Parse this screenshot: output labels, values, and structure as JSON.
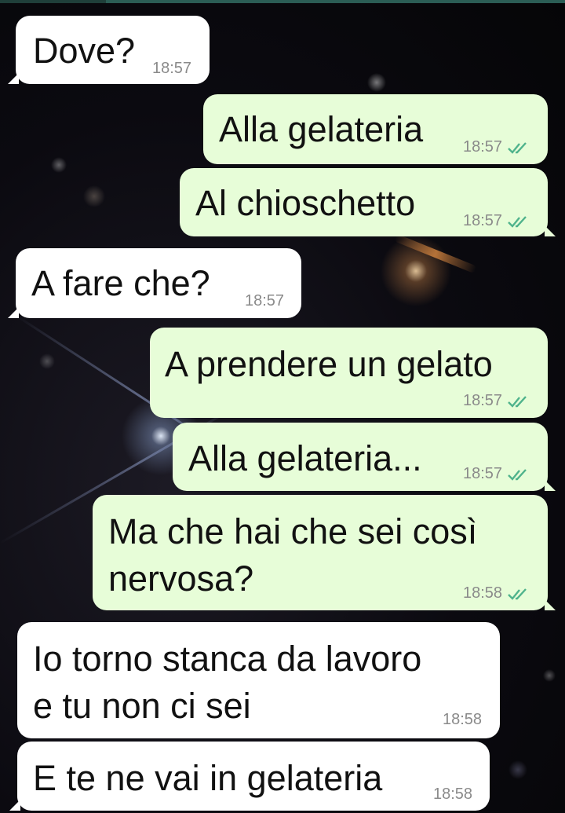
{
  "colors": {
    "incoming_bubble": "#ffffff",
    "outgoing_bubble": "#e7fdd8",
    "read_ticks": "#4fb38c",
    "timestamp": "#8a8a8a"
  },
  "messages": [
    {
      "direction": "in",
      "lines": [
        "Dove?"
      ],
      "time": "18:57"
    },
    {
      "direction": "out",
      "lines": [
        "Alla gelateria"
      ],
      "time": "18:57",
      "status_icon": "double-check-read"
    },
    {
      "direction": "out",
      "lines": [
        "Al chioschetto"
      ],
      "time": "18:57",
      "status_icon": "double-check-read"
    },
    {
      "direction": "in",
      "lines": [
        "A fare che?"
      ],
      "time": "18:57"
    },
    {
      "direction": "out",
      "lines": [
        "A prendere un gelato"
      ],
      "time": "18:57",
      "status_icon": "double-check-read"
    },
    {
      "direction": "out",
      "lines": [
        "Alla gelateria..."
      ],
      "time": "18:57",
      "status_icon": "double-check-read"
    },
    {
      "direction": "out",
      "lines": [
        "Ma che hai che sei così",
        "nervosa?"
      ],
      "time": "18:58",
      "status_icon": "double-check-read"
    },
    {
      "direction": "in",
      "lines": [
        "Io torno stanca da lavoro",
        "e tu non ci sei"
      ],
      "time": "18:58"
    },
    {
      "direction": "in",
      "lines": [
        "E te ne vai in gelateria"
      ],
      "time": "18:58"
    }
  ]
}
